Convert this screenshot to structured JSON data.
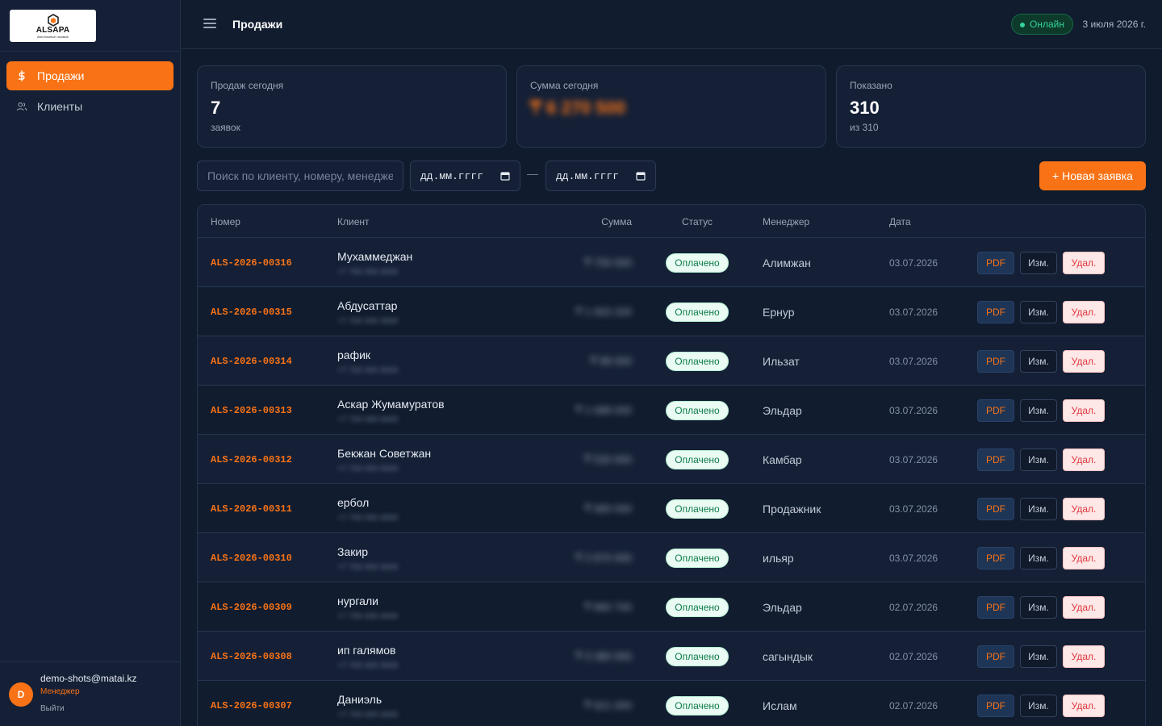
{
  "brand": {
    "logo_text": "ALSAPA",
    "logo_sub": "Автономные газовые"
  },
  "sidebar": {
    "items": [
      {
        "label": "Продажи",
        "icon": "dollar-icon",
        "active": true
      },
      {
        "label": "Клиенты",
        "icon": "users-icon",
        "active": false
      }
    ],
    "user": {
      "initial": "D",
      "email": "demo-shots@matai.kz",
      "role": "Менеджер",
      "logout": "Выйти"
    }
  },
  "header": {
    "title": "Продажи",
    "status": "Онлайн",
    "date": "3 июля 2026 г."
  },
  "stats": {
    "today": {
      "label": "Продаж сегодня",
      "value": "7",
      "sub": "заявок"
    },
    "sum": {
      "label": "Сумма сегодня",
      "value": "₸ 6 270 500"
    },
    "shown": {
      "label": "Показано",
      "value": "310",
      "sub": "из 310"
    }
  },
  "filters": {
    "search_placeholder": "Поиск по клиенту, номеру, менеджеру",
    "date_from": "дд.мм.гггг",
    "date_sep": "—",
    "date_to": "дд.мм.гггг",
    "new_button": "+ Новая заявка"
  },
  "table": {
    "headers": {
      "number": "Номер",
      "client": "Клиент",
      "sum": "Сумма",
      "status": "Статус",
      "manager": "Менеджер",
      "date": "Дата"
    },
    "actions": {
      "pdf": "PDF",
      "edit": "Изм.",
      "delete": "Удал."
    },
    "rows": [
      {
        "number": "ALS-2026-00316",
        "client": "Мухаммеджан",
        "phone": "+7 700 000 0000",
        "sum": "₸ 750 000",
        "status": "Оплачено",
        "manager": "Алимжан",
        "date": "03.07.2026"
      },
      {
        "number": "ALS-2026-00315",
        "client": "Абдусаттар",
        "phone": "+7 700 000 0000",
        "sum": "₸ 1 603 200",
        "status": "Оплачено",
        "manager": "Ернур",
        "date": "03.07.2026"
      },
      {
        "number": "ALS-2026-00314",
        "client": "рафик",
        "phone": "+7 700 000 0000",
        "sum": "₸ 88 000",
        "status": "Оплачено",
        "manager": "Ильзат",
        "date": "03.07.2026"
      },
      {
        "number": "ALS-2026-00313",
        "client": "Аскар Жумамуратов",
        "phone": "+7 700 000 0000",
        "sum": "₸ 1 688 000",
        "status": "Оплачено",
        "manager": "Эльдар",
        "date": "03.07.2026"
      },
      {
        "number": "ALS-2026-00312",
        "client": "Бекжан Советжан",
        "phone": "+7 700 000 0000",
        "sum": "₸ 520 000",
        "status": "Оплачено",
        "manager": "Камбар",
        "date": "03.07.2026"
      },
      {
        "number": "ALS-2026-00311",
        "client": "ербол",
        "phone": "+7 700 000 0000",
        "sum": "₸ 680 000",
        "status": "Оплачено",
        "manager": "Продажник",
        "date": "03.07.2026"
      },
      {
        "number": "ALS-2026-00310",
        "client": "Закир",
        "phone": "+7 700 000 0000",
        "sum": "₸ 2 870 000",
        "status": "Оплачено",
        "manager": "ильяр",
        "date": "03.07.2026"
      },
      {
        "number": "ALS-2026-00309",
        "client": "нургали",
        "phone": "+7 700 000 0000",
        "sum": "₸ 860 700",
        "status": "Оплачено",
        "manager": "Эльдар",
        "date": "02.07.2026"
      },
      {
        "number": "ALS-2026-00308",
        "client": "ип галямов",
        "phone": "+7 700 000 0000",
        "sum": "₸ 3 380 000",
        "status": "Оплачено",
        "manager": "сагындык",
        "date": "02.07.2026"
      },
      {
        "number": "ALS-2026-00307",
        "client": "Даниэль",
        "phone": "+7 700 000 0000",
        "sum": "₸ 621 000",
        "status": "Оплачено",
        "manager": "Ислам",
        "date": "02.07.2026"
      }
    ]
  }
}
